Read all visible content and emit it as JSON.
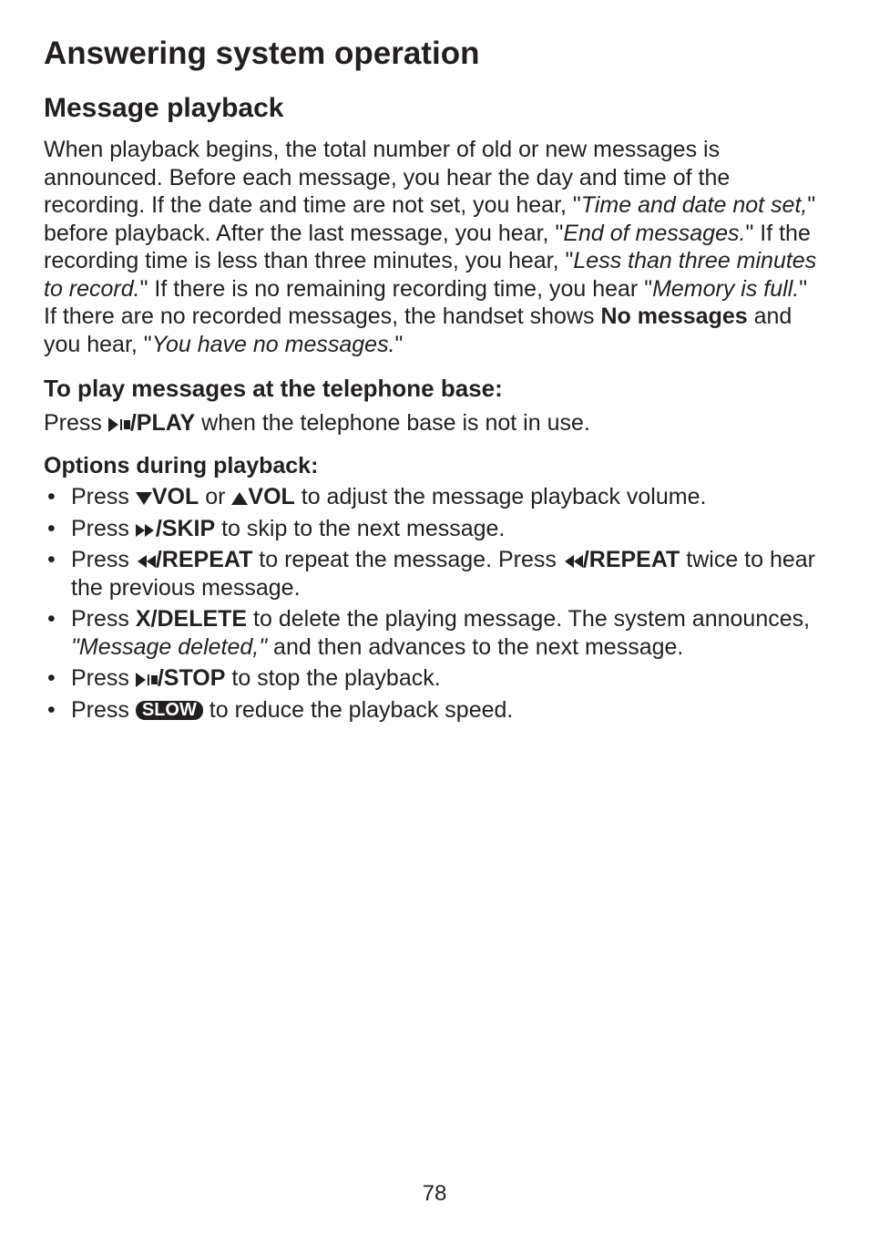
{
  "page": {
    "title": "Answering system operation",
    "section_title": "Message playback",
    "intro_parts": {
      "p1": "When playback begins, the total number of old or new messages is announced. Before each message, you hear the day and time of the recording. If the date and time are not set, you hear, \"",
      "i1": "Time and date not set,",
      "p2": "\" before playback. After the last message, you hear, \"",
      "i2": "End of messages.",
      "p3": "\" If the recording time is less than three minutes, you hear, \"",
      "i3": "Less than three minutes to record.",
      "p4": "\" If there is no remaining recording time, you hear \"",
      "i4": "Memory is full.",
      "p5": "\" If there are no recorded messages, the handset shows ",
      "b1": "No messages",
      "p6": " and you hear, \"",
      "i5": "You have no messages.",
      "p7": "\""
    },
    "sub1": {
      "heading": "To play messages at the telephone base:",
      "line_pre": "Press ",
      "btn": "/PLAY",
      "line_post": " when the telephone base is not in use."
    },
    "sub2": {
      "heading": "Options during playback:",
      "items": {
        "vol": {
          "pre": "Press ",
          "b1": "VOL",
          "mid": " or ",
          "b2": "VOL",
          "post": " to adjust the message playback volume."
        },
        "skip": {
          "pre": "Press ",
          "b": "/SKIP",
          "post": " to skip to the next message."
        },
        "repeat": {
          "pre": "Press ",
          "b1": "/REPEAT",
          "mid": " to repeat the message. Press ",
          "b2": "/REPEAT",
          "post": " twice to hear the previous message."
        },
        "delete": {
          "pre": "Press ",
          "b": "X/DELETE",
          "mid": " to delete the playing message. The system announces, ",
          "i": "\"Message deleted,\"",
          "post": " and then advances to the next message."
        },
        "stop": {
          "pre": "Press  ",
          "b": "/STOP",
          "post": " to stop the playback."
        },
        "slow": {
          "pre": "Press ",
          "pill": "SLOW",
          "post": " to reduce the playback speed."
        }
      }
    },
    "page_number": "78"
  }
}
